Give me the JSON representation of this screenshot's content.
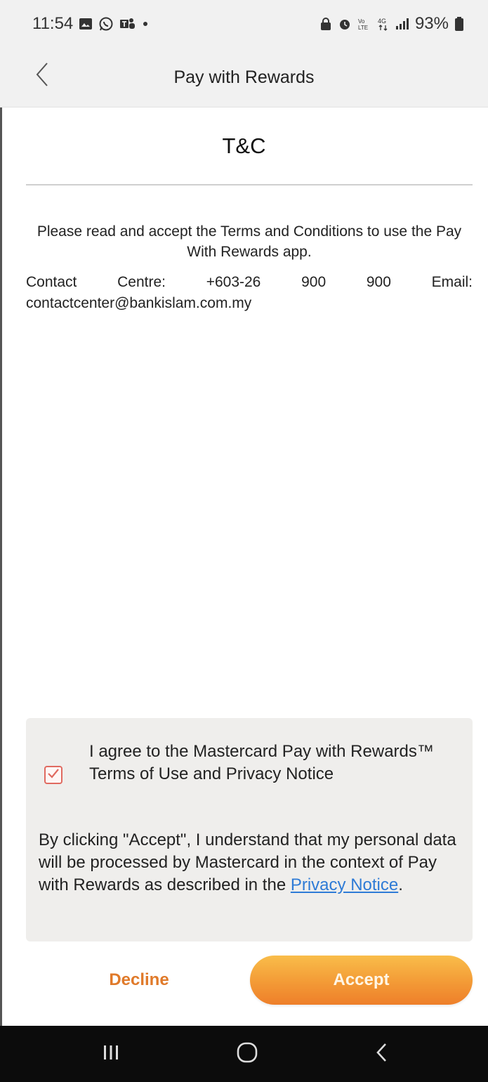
{
  "status_bar": {
    "time": "11:54",
    "battery": "93%",
    "left_icons": [
      "gallery-icon",
      "whatsapp-icon",
      "teams-icon",
      "dot-icon"
    ],
    "right_icons": [
      "lock-icon",
      "alarm-icon",
      "volte-icon",
      "data-4g-icon",
      "signal-icon",
      "battery-icon"
    ]
  },
  "header": {
    "title": "Pay with Rewards",
    "back_icon": "chevron-left-icon"
  },
  "content": {
    "title": "T&C",
    "intro": "Please read and accept the Terms and Conditions to use the Pay With Rewards app.",
    "contact_line": "Contact Centre: +603-26 900 900 Email:",
    "contact_email": "contactcenter@bankislam.com.my"
  },
  "consent": {
    "checked": true,
    "agree_text": "I agree to the Mastercard Pay with Rewards™ Terms of Use and Privacy Notice",
    "note_prefix": "By clicking \"Accept\", I understand that my personal data will be processed by Mastercard in the context of Pay with Rewards as described in the ",
    "privacy_link": "Privacy Notice",
    "note_suffix": "."
  },
  "actions": {
    "decline_label": "Decline",
    "accept_label": "Accept"
  },
  "colors": {
    "accent": "#f39a36",
    "decline_text": "#e07a2a",
    "link": "#2e7bd6",
    "checkbox": "#e06a60"
  },
  "nav_bar": {
    "icons": [
      "recent-apps-icon",
      "home-icon",
      "back-icon"
    ]
  }
}
